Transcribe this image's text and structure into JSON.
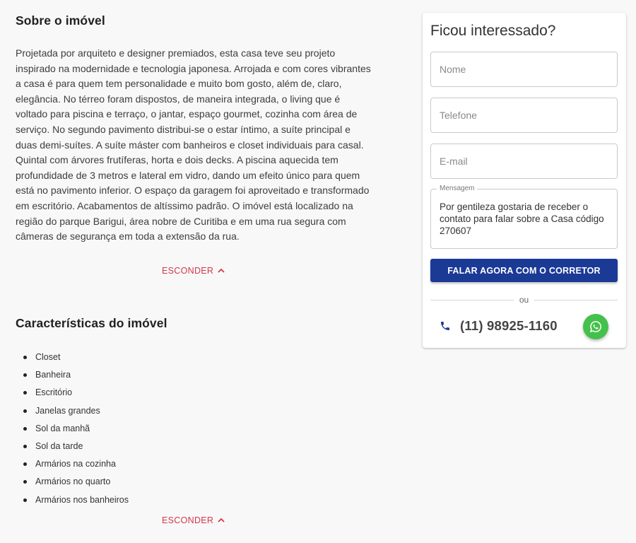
{
  "about": {
    "title": "Sobre o imóvel",
    "text": "Projetada por arquiteto e designer premiados, esta casa teve seu projeto inspirado na modernidade e tecnologia japonesa. Arrojada e com cores vibrantes a casa é para quem tem personalidade e muito bom gosto, além de, claro, elegância. No térreo foram dispostos, de maneira integrada, o living que é voltado para piscina e terraço, o jantar, espaço gourmet, cozinha com área de serviço. No segundo pavimento distribui-se o estar íntimo, a suíte principal e duas demi-suítes. A suíte máster com banheiros e closet individuais para casal. Quintal com árvores frutíferas, horta e dois decks. A piscina aquecida tem profundidade de 3 metros e lateral em vidro, dando um efeito único para quem está no pavimento inferior. O espaço da garagem foi aproveitado e transformado em escritório. Acabamentos de altíssimo padrão. O imóvel está localizado na região do parque Barigui, área nobre de Curitiba e em uma rua segura com câmeras de segurança em toda a extensão da rua.",
    "toggle_label": "ESCONDER"
  },
  "features": {
    "title": "Características do imóvel",
    "items": [
      "Closet",
      "Banheira",
      "Escritório",
      "Janelas grandes",
      "Sol da manhã",
      "Sol da tarde",
      "Armários na cozinha",
      "Armários no quarto",
      "Armários nos banheiros"
    ],
    "toggle_label": "ESCONDER"
  },
  "contact": {
    "title": "Ficou interessado?",
    "name_placeholder": "Nome",
    "phone_placeholder": "Telefone",
    "email_placeholder": "E-mail",
    "message_label": "Mensagem",
    "message_value": "Por gentileza gostaria de receber o contato para falar sobre a Casa código 270607",
    "cta_label": "FALAR AGORA COM O CORRETOR",
    "or_label": "ou",
    "phone_number": "(11) 98925-1160"
  },
  "icons": {
    "toggle": "chevron-up-icon",
    "phone": "phone-icon",
    "whatsapp": "whatsapp-icon"
  },
  "colors": {
    "accent_red": "#d2384a",
    "primary_blue": "#1a3a96",
    "whatsapp_green": "#43c14b",
    "phone_icon_blue": "#1a3a96"
  }
}
